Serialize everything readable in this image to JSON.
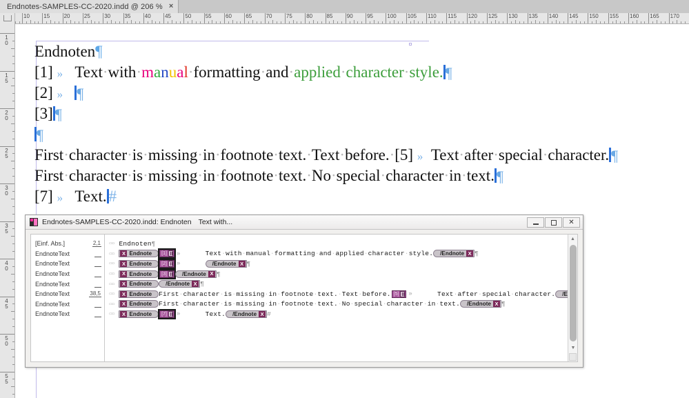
{
  "app": {
    "tab_title": "Endnotes-SAMPLES-CC-2020.indd @ 206 %",
    "tab_close": "×"
  },
  "rulers": {
    "horizontal_unit_start": 10,
    "horizontal_labels": [
      10,
      15,
      20,
      25,
      30,
      35,
      40,
      45,
      50,
      55,
      60,
      65,
      70,
      75,
      80,
      85,
      90,
      95,
      100,
      105,
      110,
      115,
      120,
      125,
      130,
      135,
      140,
      145,
      150,
      155,
      160,
      165,
      170
    ],
    "vertical_labels": [
      10,
      15,
      20,
      25,
      30,
      35,
      40,
      45,
      50,
      55
    ]
  },
  "document": {
    "heading": "Endnoten",
    "lines": [
      {
        "id": "line-endnote-1",
        "number": "[1]",
        "tab": "»",
        "segments": [
          {
            "text": "Text",
            "color": "black"
          },
          {
            "text": "with",
            "color": "black"
          },
          {
            "text": "manual",
            "color": "rainbow"
          },
          {
            "text": "formatting",
            "color": "black"
          },
          {
            "text": "and",
            "color": "black"
          },
          {
            "text": "applied",
            "color": "green"
          },
          {
            "text": "character",
            "color": "green"
          },
          {
            "text": "style.",
            "color": "green"
          }
        ],
        "plain": "Text with manual formatting and applied character style."
      },
      {
        "id": "line-endnote-2",
        "number": "[2]",
        "tab": "»",
        "plain": ""
      },
      {
        "id": "line-endnote-3",
        "number": "[3]",
        "tab": "",
        "plain": ""
      },
      {
        "id": "line-blank",
        "number": "",
        "tab": "",
        "plain": ""
      },
      {
        "id": "line-endnote-4",
        "number": "",
        "tab": "",
        "plain": "First character is missing in footnote text. Text before."
      },
      {
        "id": "line-endnote-5",
        "number": "[5]",
        "tab": "»",
        "plain": "Text after special character."
      },
      {
        "id": "line-endnote-6",
        "number": "",
        "tab": "",
        "plain": "First character is missing in footnote text. No special character in text."
      },
      {
        "id": "line-endnote-7",
        "number": "[7]",
        "tab": "»",
        "plain": "Text."
      }
    ],
    "manual_letters": [
      {
        "ch": "m",
        "color": "#e8007d"
      },
      {
        "ch": "a",
        "color": "#2fa83c"
      },
      {
        "ch": "n",
        "color": "#2348c4"
      },
      {
        "ch": "u",
        "color": "#f2c200"
      },
      {
        "ch": "a",
        "color": "#e8007d"
      },
      {
        "ch": "l",
        "color": "#e03124"
      }
    ],
    "colors": {
      "character_style_green": "#3d9e3c",
      "cursor_blue": "#2a6fd8",
      "pilcrow_blue": "#6aa9e4",
      "frame_guide": "#c0b9ea"
    }
  },
  "story_editor": {
    "title": "Endnotes-SAMPLES-CC-2020.indd: Endnoten",
    "subtitle": "Text with...",
    "window_buttons": {
      "minimize": "–",
      "maximize": "□",
      "close": "✕"
    },
    "style_column": [
      {
        "style": "[Einf. Abs.]",
        "depth": "2,1"
      },
      {
        "style": "EndnoteText",
        "depth": ""
      },
      {
        "style": "EndnoteText",
        "depth": ""
      },
      {
        "style": "EndnoteText",
        "depth": ""
      },
      {
        "style": "EndnoteText",
        "depth": ""
      },
      {
        "style": "EndnoteText",
        "depth": "38,5"
      },
      {
        "style": "EndnoteText",
        "depth": ""
      },
      {
        "style": "EndnoteText",
        "depth": ""
      }
    ],
    "tag_labels": {
      "open": "Endnote",
      "close": "/Endnote",
      "x": "X"
    },
    "lines": [
      {
        "id": "se-line-0",
        "parts": [
          {
            "type": "text",
            "value": "Endnoten"
          },
          {
            "type": "pilcrow",
            "value": "¶"
          }
        ]
      },
      {
        "id": "se-line-1",
        "parts": [
          {
            "type": "tag-open",
            "value": "Endnote"
          },
          {
            "type": "note-marker",
            "value": "[1]",
            "selected": true
          },
          {
            "type": "tab",
            "value": "»"
          },
          {
            "type": "text",
            "value": "Text with manual formatting and applied character style."
          },
          {
            "type": "tag-close",
            "value": "/Endnote"
          },
          {
            "type": "pilcrow",
            "value": "¶"
          }
        ]
      },
      {
        "id": "se-line-2",
        "parts": [
          {
            "type": "tag-open",
            "value": "Endnote"
          },
          {
            "type": "note-marker",
            "value": "[2]",
            "selected": true
          },
          {
            "type": "tab",
            "value": "»"
          },
          {
            "type": "tag-close",
            "value": "/Endnote"
          },
          {
            "type": "pilcrow",
            "value": "¶"
          }
        ]
      },
      {
        "id": "se-line-3",
        "parts": [
          {
            "type": "tag-open",
            "value": "Endnote"
          },
          {
            "type": "note-marker",
            "value": "[3]",
            "selected": true
          },
          {
            "type": "tag-close",
            "value": "/Endnote"
          },
          {
            "type": "pilcrow",
            "value": "¶"
          }
        ]
      },
      {
        "id": "se-line-4",
        "parts": [
          {
            "type": "tag-open",
            "value": "Endnote"
          },
          {
            "type": "tag-close",
            "value": "/Endnote"
          },
          {
            "type": "pilcrow",
            "value": "¶"
          }
        ]
      },
      {
        "id": "se-line-5",
        "parts": [
          {
            "type": "tag-open",
            "value": "Endnote"
          },
          {
            "type": "text",
            "value": "First character is missing in footnote text. Text before."
          },
          {
            "type": "note-marker",
            "value": "[5]",
            "selected": false
          },
          {
            "type": "tab",
            "value": "»"
          },
          {
            "type": "text",
            "value": "Text after special character."
          },
          {
            "type": "tag-close",
            "value": "/Endnote"
          },
          {
            "type": "pilcrow",
            "value": "¶"
          }
        ]
      },
      {
        "id": "se-line-6",
        "parts": [
          {
            "type": "tag-open",
            "value": "Endnote"
          },
          {
            "type": "text",
            "value": "First character is missing in footnote text. No special character in text."
          },
          {
            "type": "tag-close",
            "value": "/Endnote"
          },
          {
            "type": "pilcrow",
            "value": "¶"
          }
        ]
      },
      {
        "id": "se-line-7",
        "parts": [
          {
            "type": "tag-open",
            "value": "Endnote"
          },
          {
            "type": "note-marker",
            "value": "[7]",
            "selected": true
          },
          {
            "type": "tab",
            "value": "»"
          },
          {
            "type": "text",
            "value": "Text."
          },
          {
            "type": "tag-close",
            "value": "/Endnote"
          },
          {
            "type": "endmark",
            "value": "#"
          }
        ]
      }
    ]
  }
}
